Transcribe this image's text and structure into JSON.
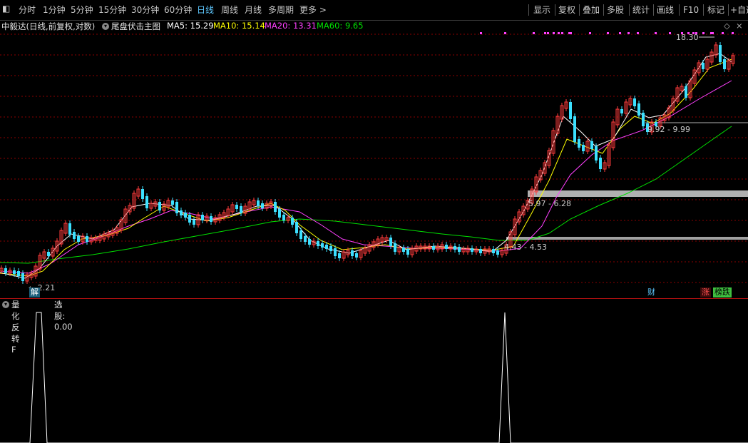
{
  "toolbar": {
    "back_glyph": "◧",
    "periods": [
      "分时",
      "1分钟",
      "5分钟",
      "15分钟",
      "30分钟",
      "60分钟",
      "日线",
      "周线",
      "月线",
      "多周期",
      "更多 >"
    ],
    "active_period": "日线",
    "right_buttons": [
      "显示",
      "复权",
      "叠加",
      "多股",
      "统计",
      "画线",
      "F10",
      "标记",
      "+自选"
    ]
  },
  "legend": {
    "stock_title": "中毅达(日线,前复权,对数)",
    "indicator_name": "尾盘伏击主图",
    "ma5": "MA5: 15.29",
    "ma10": "MA10: 15.14",
    "ma20": "MA20: 13.31",
    "ma60": "MA60: 9.65",
    "diamond": "◇",
    "close_glyph": "×"
  },
  "colors": {
    "ma5": "#ffffff",
    "ma10": "#ffff00",
    "ma20": "#ff40ff",
    "ma60": "#00e000",
    "up": "#ff3c3c",
    "down": "#3ce0ff",
    "grid": "#8b0000"
  },
  "annotations": {
    "high_label": "18.30",
    "low_label": "2.21",
    "zone1": "4.43 - 4.53",
    "zone2": "5.97 - 6.28",
    "zone3": "9.92 - 9.99",
    "jie": "解",
    "cai": "财",
    "zhang": "涨",
    "bangdie": "榜跌"
  },
  "indicator": {
    "name": "量化反转F",
    "value": "选股: 0.00"
  }
}
